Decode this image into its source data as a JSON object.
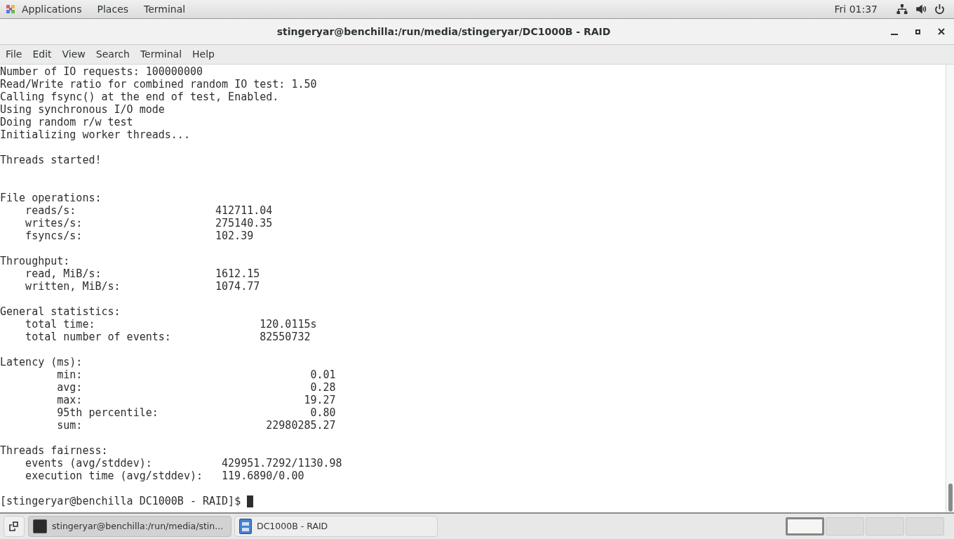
{
  "top_bar": {
    "menus": [
      "Applications",
      "Places",
      "Terminal"
    ],
    "clock": "Fri 01:37"
  },
  "window": {
    "title": "stingeryar@benchilla:/run/media/stingeryar/DC1000B - RAID",
    "menu": [
      "File",
      "Edit",
      "View",
      "Search",
      "Terminal",
      "Help"
    ]
  },
  "terminal": {
    "preamble": [
      "Number of IO requests: 100000000",
      "Read/Write ratio for combined random IO test: 1.50",
      "Calling fsync() at the end of test, Enabled.",
      "Using synchronous I/O mode",
      "Doing random r/w test",
      "Initializing worker threads..."
    ],
    "started": "Threads started!",
    "sections": [
      {
        "heading": "File operations:",
        "rows": [
          {
            "label": "reads/s:",
            "value": "412711.04"
          },
          {
            "label": "writes/s:",
            "value": "275140.35"
          },
          {
            "label": "fsyncs/s:",
            "value": "102.39"
          }
        ]
      },
      {
        "heading": "Throughput:",
        "rows": [
          {
            "label": "read, MiB/s:",
            "value": "1612.15"
          },
          {
            "label": "written, MiB/s:",
            "value": "1074.77"
          }
        ]
      },
      {
        "heading": "General statistics:",
        "rows": [
          {
            "label": "total time:",
            "value": "120.0115s"
          },
          {
            "label": "total number of events:",
            "value": "82550732"
          }
        ]
      },
      {
        "heading": "Latency (ms):",
        "rows": [
          {
            "label": "min:",
            "value": "0.01"
          },
          {
            "label": "avg:",
            "value": "0.28"
          },
          {
            "label": "max:",
            "value": "19.27"
          },
          {
            "label": "95th percentile:",
            "value": "0.80"
          },
          {
            "label": "sum:",
            "value": "22980285.27"
          }
        ]
      },
      {
        "heading": "Threads fairness:",
        "rows": [
          {
            "label": "events (avg/stddev):",
            "value": "429951.7292/1130.98"
          },
          {
            "label": "execution time (avg/stddev):",
            "value": "119.6890/0.00"
          }
        ]
      }
    ],
    "prompt": "[stingeryar@benchilla DC1000B - RAID]$"
  },
  "taskbar": {
    "windows": [
      {
        "kind": "terminal",
        "label": "stingeryar@benchilla:/run/media/stin...",
        "selected": true
      },
      {
        "kind": "cabinet",
        "label": "DC1000B - RAID",
        "selected": false
      }
    ],
    "workspaces": [
      {
        "selected": true
      },
      {
        "selected": false
      },
      {
        "selected": false
      },
      {
        "selected": false
      }
    ]
  }
}
